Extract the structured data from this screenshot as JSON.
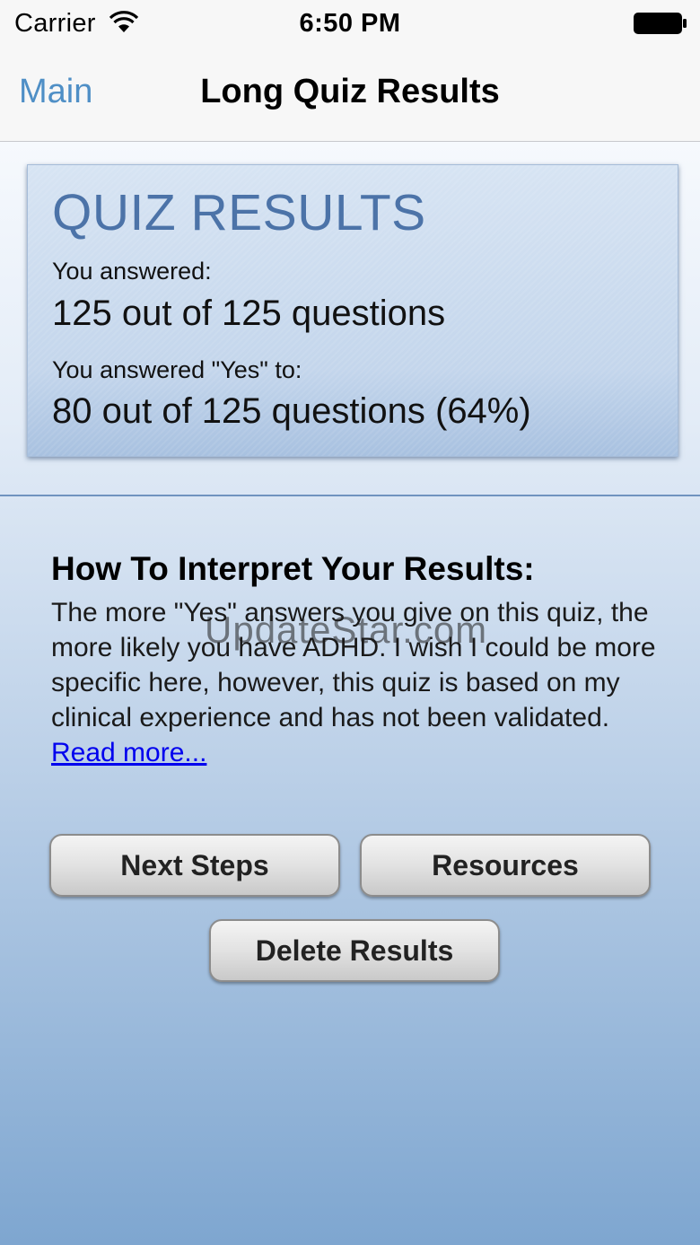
{
  "status_bar": {
    "carrier": "Carrier",
    "time": "6:50 PM",
    "wifi_icon": "wifi-icon",
    "battery_icon": "battery-icon"
  },
  "nav": {
    "back_label": "Main",
    "title": "Long Quiz Results"
  },
  "results": {
    "title": "QUIZ RESULTS",
    "answered_label": "You answered:",
    "answered_value": "125 out of 125 questions",
    "yes_label": "You answered \"Yes\" to:",
    "yes_value": "80 out of 125 questions (64%)"
  },
  "interpret": {
    "heading": "How To Interpret Your Results:",
    "body": "The more \"Yes\" answers you give on this quiz, the more likely you have ADHD. I wish I could be more specific here, however, this quiz is based on my clinical experience and has not been validated. ",
    "read_more": "Read more..."
  },
  "watermark": "UpdateStar.com",
  "buttons": {
    "next_steps": "Next Steps",
    "resources": "Resources",
    "delete_results": "Delete Results"
  },
  "colors": {
    "nav_link": "#4f8fc6",
    "card_title": "#4c73a8",
    "link": "#0000ee"
  }
}
